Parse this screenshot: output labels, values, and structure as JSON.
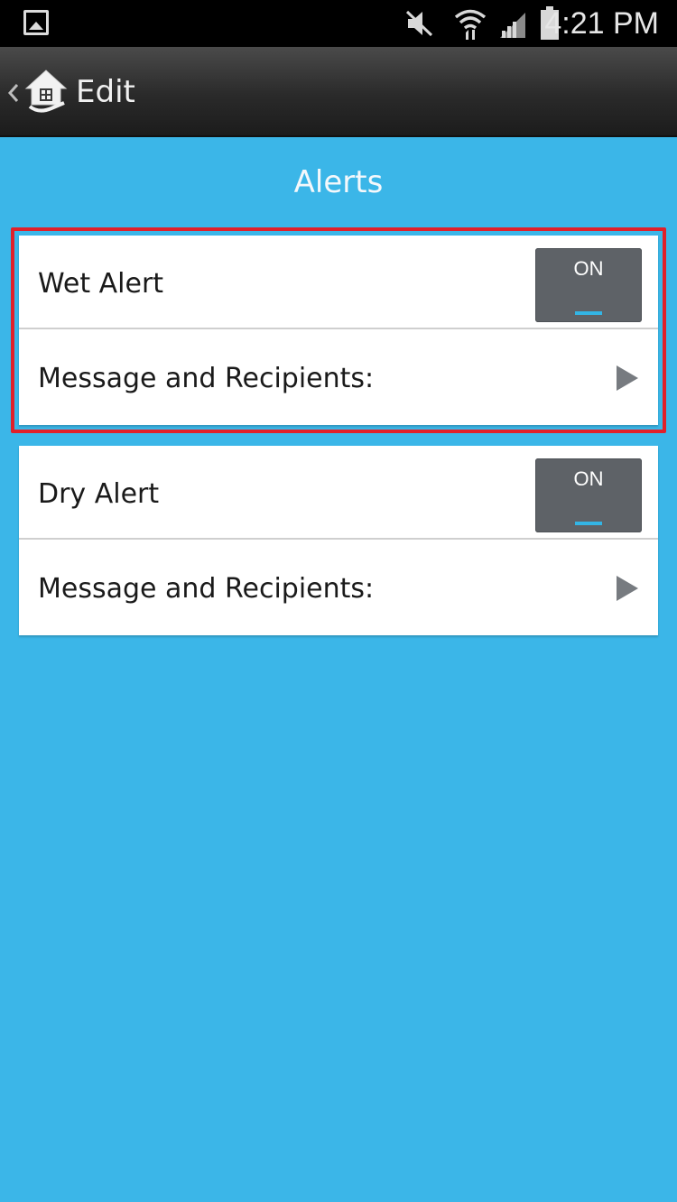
{
  "status_bar": {
    "time": "4:21 PM",
    "icons": [
      "gallery-icon",
      "mute-icon",
      "wifi-icon",
      "signal-icon",
      "battery-icon"
    ]
  },
  "action_bar": {
    "title": "Edit",
    "icons": [
      "chevron-left-icon",
      "home-icon"
    ]
  },
  "page": {
    "title": "Alerts"
  },
  "alerts": [
    {
      "label": "Wet Alert",
      "toggle": "ON",
      "submenu_label": "Message and Recipients:",
      "highlighted": true
    },
    {
      "label": "Dry Alert",
      "toggle": "ON",
      "submenu_label": "Message and Recipients:",
      "highlighted": false
    }
  ],
  "colors": {
    "background": "#3bb6e8",
    "highlight": "#e0202a",
    "toggle_bg": "#5e6267",
    "toggle_indicator": "#33b5e5"
  }
}
